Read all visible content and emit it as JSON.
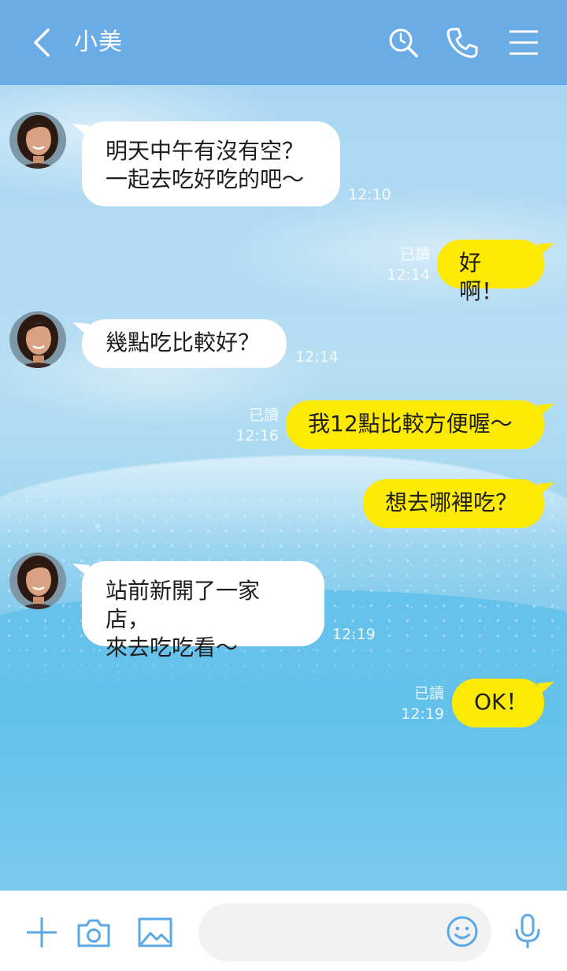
{
  "header": {
    "title": "小美",
    "icons": [
      "back-arrow-icon",
      "search-icon",
      "phone-icon",
      "menu-icon"
    ],
    "color": "#6aace6"
  },
  "messages": [
    {
      "side": "left",
      "text": "明天中午有沒有空？\n一起去吃好吃的吧～",
      "time": "12:10"
    },
    {
      "side": "right",
      "text": "好啊！",
      "read": "已讀",
      "time": "12:14"
    },
    {
      "side": "left",
      "text": "幾點吃比較好？",
      "time": "12:14"
    },
    {
      "side": "right",
      "text": "我12點比較方便喔～",
      "read": "已讀",
      "time": "12:16"
    },
    {
      "side": "right",
      "text": "想去哪裡吃？",
      "read": "",
      "time": ""
    },
    {
      "side": "left",
      "text": "站前新開了一家店，\n來去吃吃看～",
      "time": "12:19"
    },
    {
      "side": "right",
      "text": "OK！",
      "read": "已讀",
      "time": "12:19"
    }
  ],
  "input": {
    "placeholder": "",
    "icons": [
      "plus-icon",
      "camera-icon",
      "image-icon",
      "emoji-icon",
      "microphone-icon"
    ]
  },
  "colors": {
    "bubble_left": "#ffffff",
    "bubble_right": "#fcea05",
    "accent": "#5aa9e6"
  }
}
